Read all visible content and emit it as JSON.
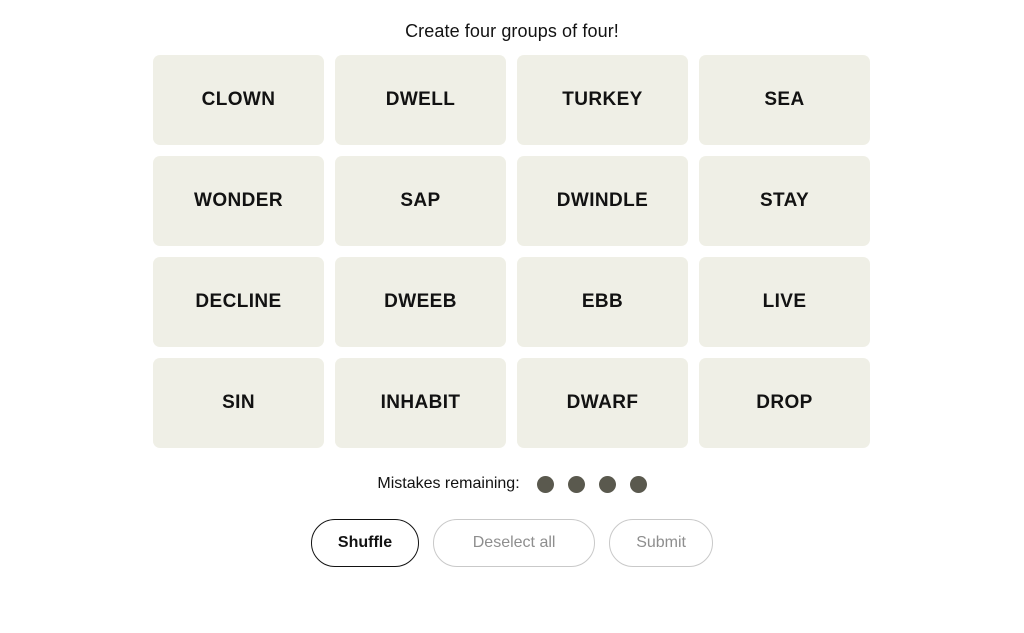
{
  "game": {
    "title": "Create four groups of four!",
    "tiles": [
      {
        "label": "CLOWN"
      },
      {
        "label": "DWELL"
      },
      {
        "label": "TURKEY"
      },
      {
        "label": "SEA"
      },
      {
        "label": "WONDER"
      },
      {
        "label": "SAP"
      },
      {
        "label": "DWINDLE"
      },
      {
        "label": "STAY"
      },
      {
        "label": "DECLINE"
      },
      {
        "label": "DWEEB"
      },
      {
        "label": "EBB"
      },
      {
        "label": "LIVE"
      },
      {
        "label": "SIN"
      },
      {
        "label": "INHABIT"
      },
      {
        "label": "DWARF"
      },
      {
        "label": "DROP"
      }
    ],
    "mistakes": {
      "label": "Mistakes remaining:",
      "remaining": 4,
      "dot_color": "#5a594e"
    },
    "actions": {
      "shuffle_label": "Shuffle",
      "deselect_label": "Deselect all",
      "submit_label": "Submit"
    },
    "colors": {
      "tile_background": "#efefe6",
      "page_background": "#ffffff",
      "text": "#121212",
      "disabled_text": "#8e8e8e",
      "disabled_border": "#c9c9c9"
    }
  }
}
